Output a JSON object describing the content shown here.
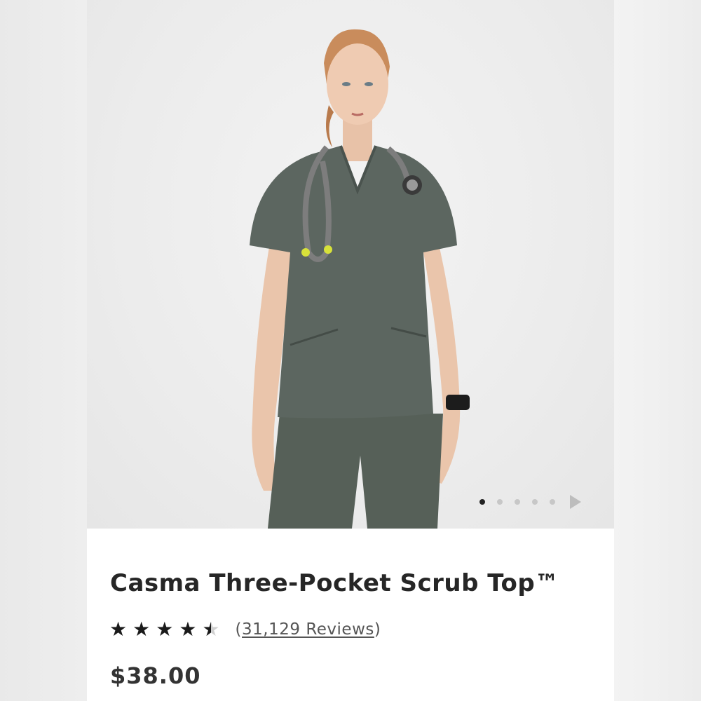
{
  "product": {
    "title": "Casma Three-Pocket Scrub Top™",
    "rating": 4.5,
    "rating_max": 5,
    "reviews_open": "(",
    "reviews_count": "31,129 Reviews",
    "reviews_close": ")",
    "price": "$38.00",
    "color_swatch": "#5c6660"
  },
  "gallery": {
    "image_description": "model wearing green scrub top with stethoscope",
    "total_images": 5,
    "active_index": 0,
    "next_icon": "play-arrow-icon"
  },
  "colors": {
    "background": "#ececec",
    "card": "#ffffff",
    "text": "#262626",
    "dot_active": "#222222",
    "dot_inactive": "#c7c7c7"
  }
}
